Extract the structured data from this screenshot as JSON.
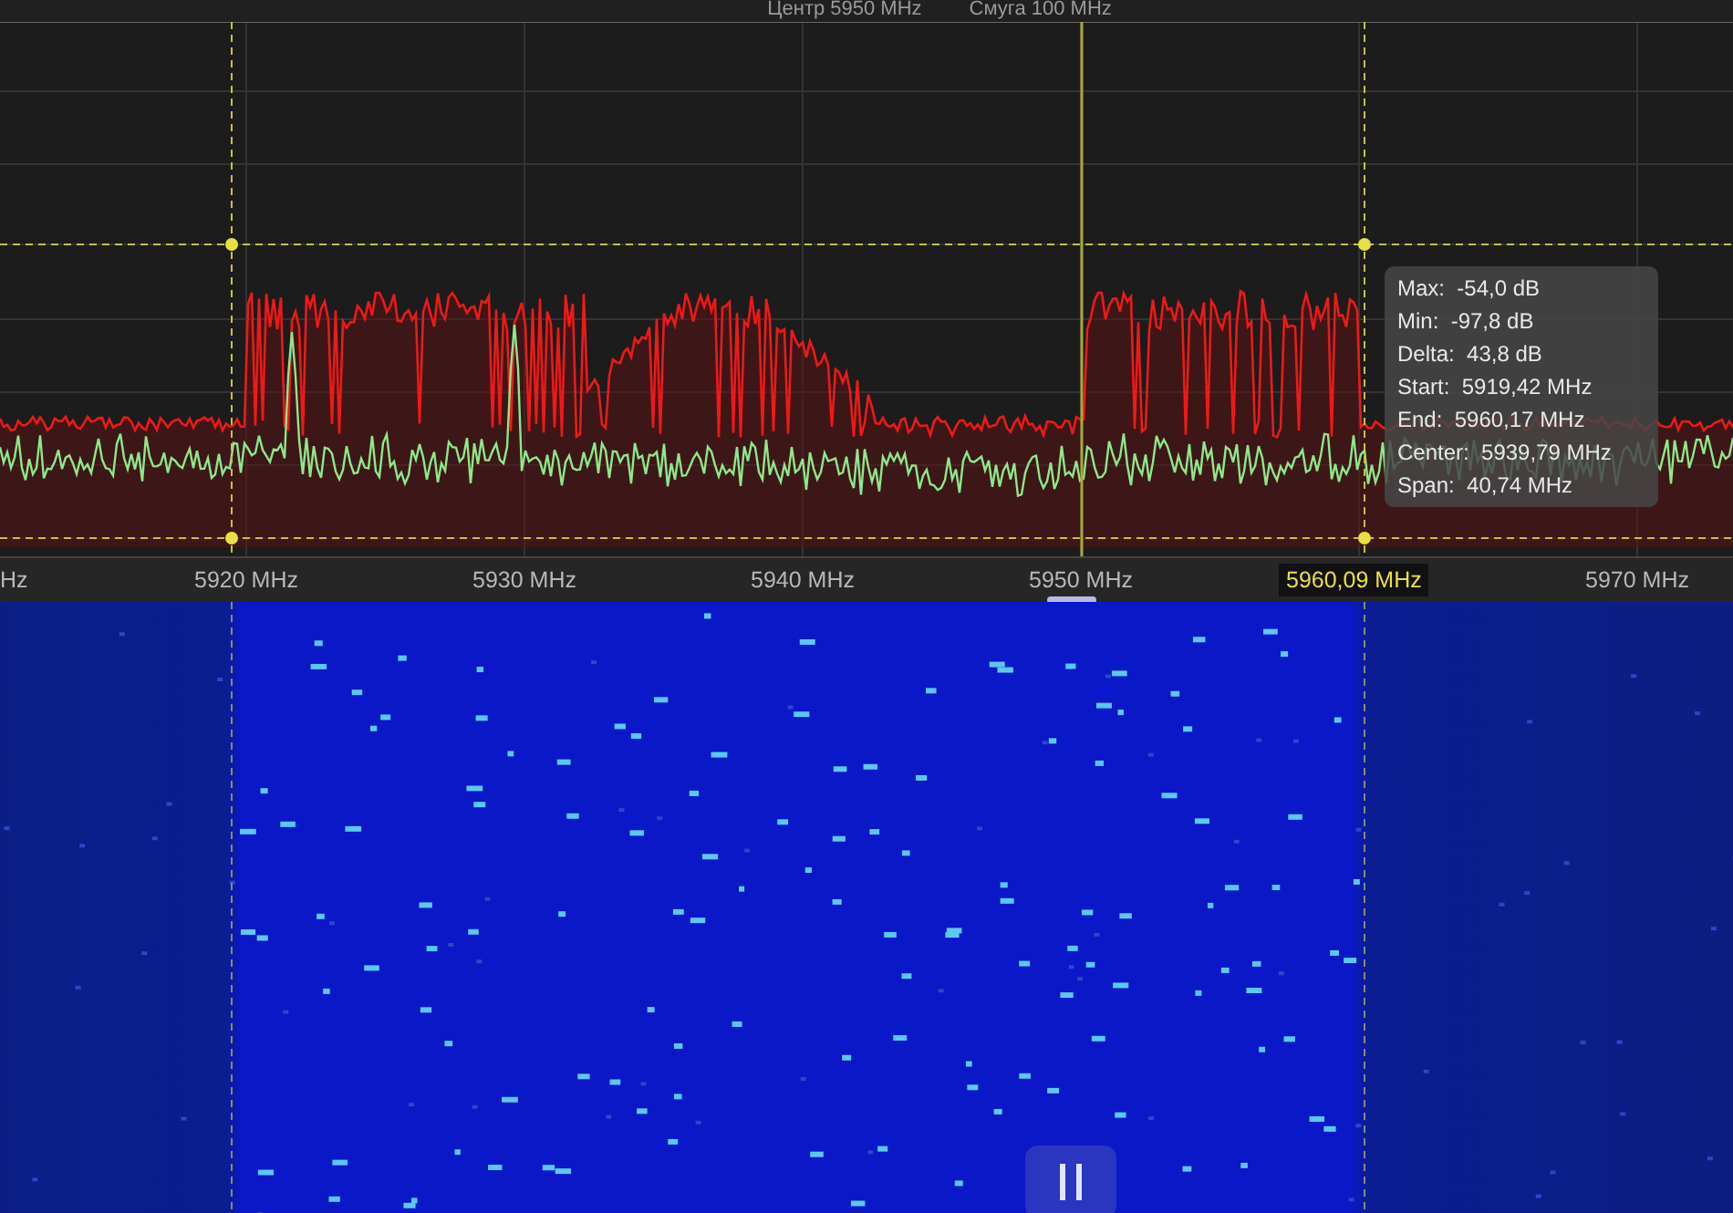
{
  "header": {
    "center": "Центр 5950 MHz",
    "span": "Смуга 100 MHz"
  },
  "measurement": {
    "lines": [
      {
        "label": "Max:",
        "value": "-54,0 dB"
      },
      {
        "label": "Min:",
        "value": "-97,8 dB"
      },
      {
        "label": "Delta:",
        "value": "43,8 dB"
      },
      {
        "label": "Start:",
        "value": "5919,42 MHz"
      },
      {
        "label": "End:",
        "value": "5960,17 MHz"
      },
      {
        "label": "Center:",
        "value": "5939,79 MHz"
      },
      {
        "label": "Span:",
        "value": "40,74 MHz"
      }
    ]
  },
  "axis": {
    "edge_label": "Hz",
    "ticks": [
      "5920 MHz",
      "5930 MHz",
      "5940 MHz",
      "5950 MHz",
      "5970 MHz"
    ],
    "cursor_label": "5960,09 MHz"
  }
}
